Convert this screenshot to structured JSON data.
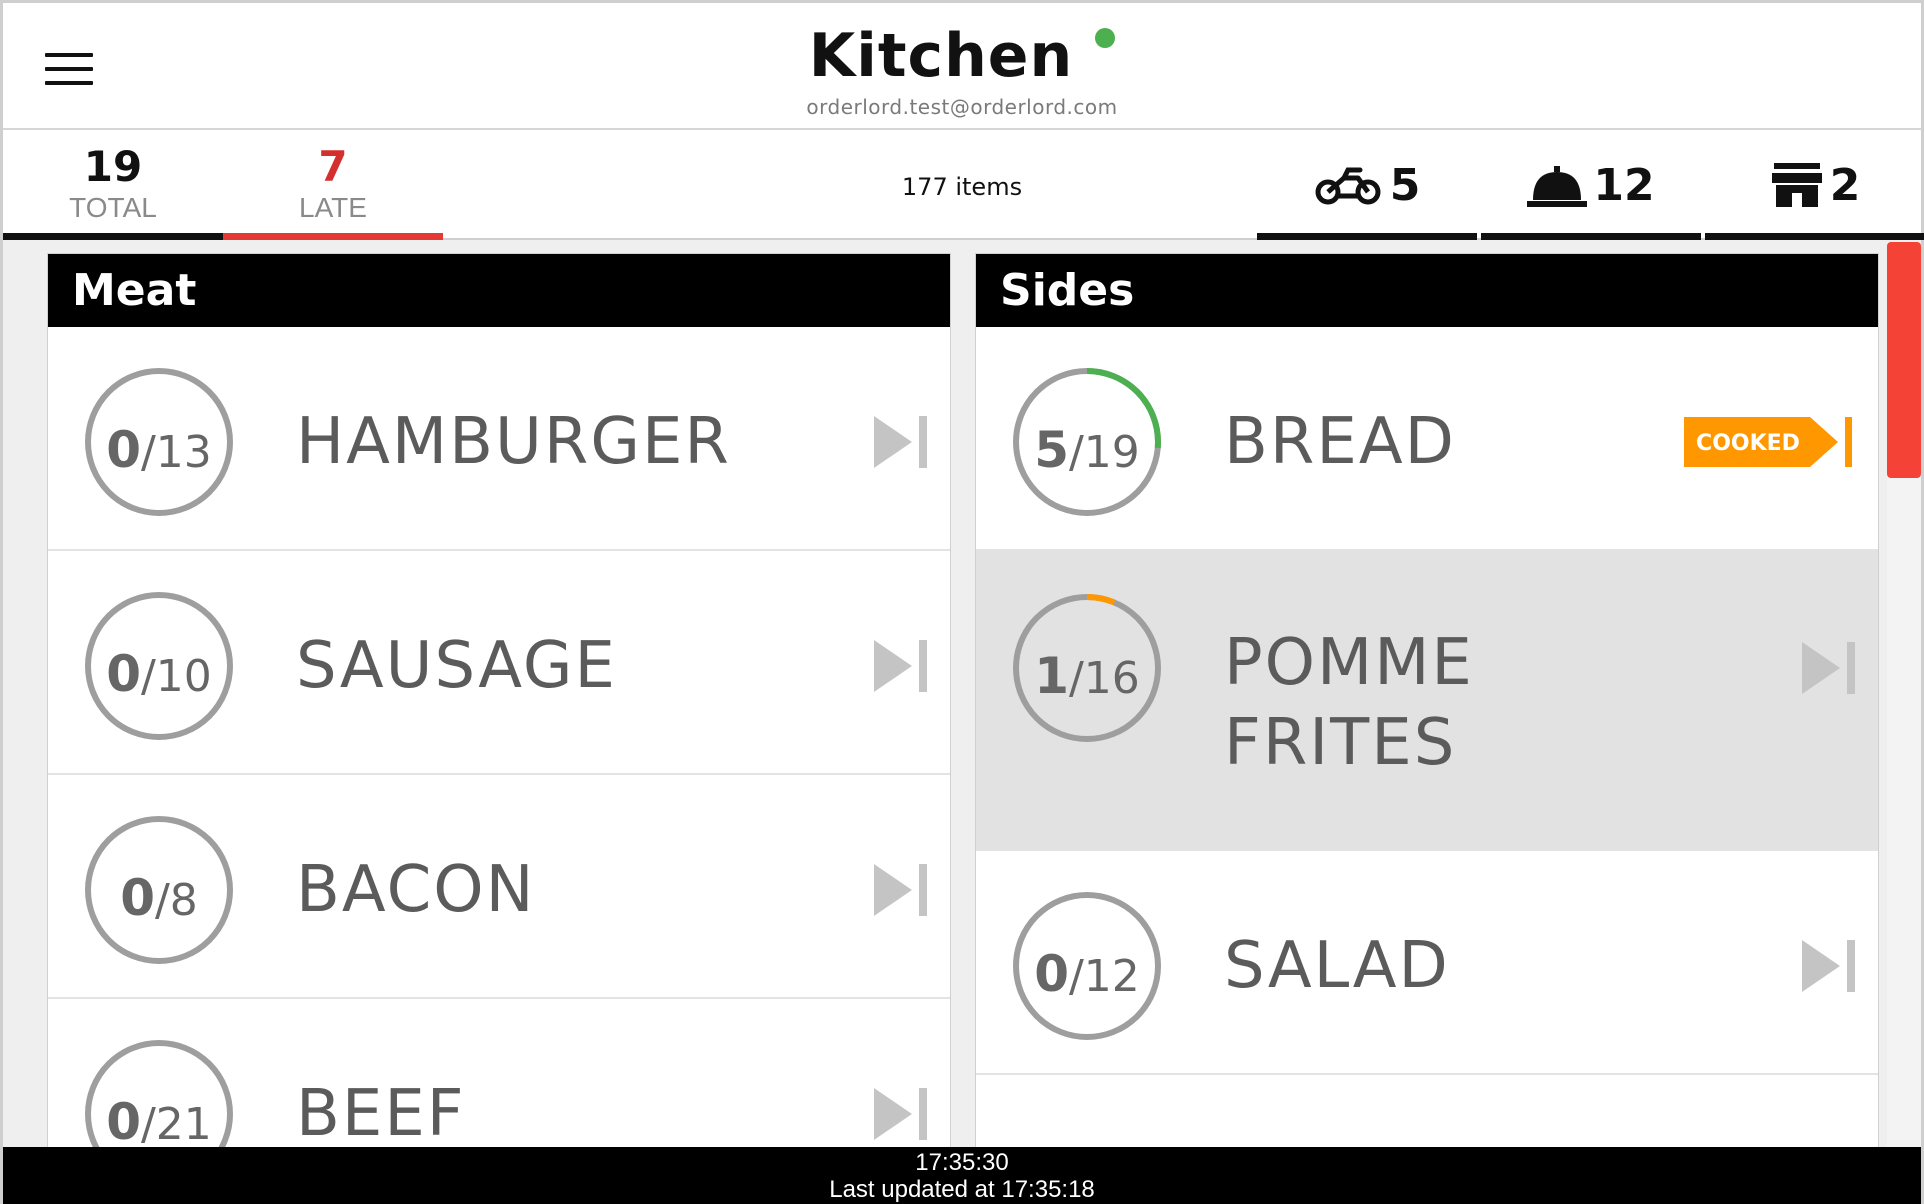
{
  "header": {
    "title": "Kitchen",
    "subtitle": "orderlord.test@orderlord.com",
    "status_color": "#4caf50",
    "menu_icon": "hamburger-menu-icon"
  },
  "tabs": [
    {
      "value": "19",
      "label": "TOTAL",
      "value_color": "#111111",
      "bar_color": "#111111"
    },
    {
      "value": "7",
      "label": "LATE",
      "value_color": "#d32f2f",
      "bar_color": "#e53935"
    }
  ],
  "items_count": "177 items",
  "stats": [
    {
      "icon": "scooter-icon",
      "value": "5"
    },
    {
      "icon": "cloche-icon",
      "value": "12"
    },
    {
      "icon": "store-icon",
      "value": "2"
    }
  ],
  "sections": [
    {
      "title": "Meat",
      "items": [
        {
          "done": "0",
          "total": "/13",
          "name": "HAMBURGER",
          "progress": 0,
          "progress_color": "#4caf50",
          "action": "skip-icon"
        },
        {
          "done": "0",
          "total": "/10",
          "name": "SAUSAGE",
          "progress": 0,
          "progress_color": "#4caf50",
          "action": "skip-icon"
        },
        {
          "done": "0",
          "total": "/8",
          "name": "BACON",
          "progress": 0,
          "progress_color": "#4caf50",
          "action": "skip-icon"
        },
        {
          "done": "0",
          "total": "/21",
          "name": "BEEF",
          "progress": 0,
          "progress_color": "#4caf50",
          "action": "skip-icon"
        }
      ]
    },
    {
      "title": "Sides",
      "items": [
        {
          "done": "5",
          "total": "/19",
          "name": "BREAD",
          "progress": 0.263,
          "progress_color": "#4caf50",
          "action": "cooked-button",
          "badge": "COOKED",
          "badge_color": "#ff9800"
        },
        {
          "done": "1",
          "total": "/16",
          "name": "POMME FRITES",
          "name_lines": [
            "POMME",
            "FRITES"
          ],
          "progress": 0.0625,
          "progress_color": "#ff9800",
          "action": "skip-icon",
          "highlighted": true
        },
        {
          "done": "0",
          "total": "/12",
          "name": "SALAD",
          "progress": 0,
          "progress_color": "#4caf50",
          "action": "skip-icon"
        }
      ]
    }
  ],
  "footer": {
    "clock": "17:35:30",
    "last_updated": "Last updated at 17:35:18"
  }
}
